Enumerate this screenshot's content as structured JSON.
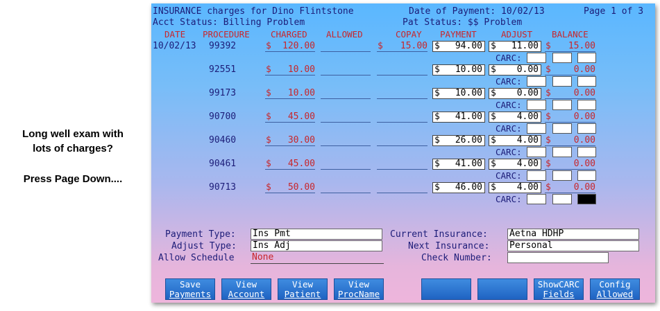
{
  "side_note": {
    "line1": "Long well exam with",
    "line2": "lots of charges?",
    "line3": "Press Page Down...."
  },
  "header": {
    "title": "INSURANCE charges for Dino Flintstone",
    "date_of_payment": "Date of Payment: 10/02/13",
    "page": "Page 1 of 3",
    "acct_status": "Acct Status: Billing Problem",
    "pat_status": "Pat Status: $$ Problem"
  },
  "columns": {
    "date": "DATE",
    "procedure": "PROCEDURE",
    "charged": "CHARGED",
    "allowed": "ALLOWED",
    "copay": "COPAY",
    "payment": "PAYMENT",
    "adjust": "ADJUST",
    "balance": "BALANCE"
  },
  "rows": [
    {
      "date": "10/02/13",
      "procedure": "99392",
      "charged": "120.00",
      "allowed": "",
      "copay": "15.00",
      "payment": "94.00",
      "adjust": "11.00",
      "balance": "15.00"
    },
    {
      "date": "",
      "procedure": "92551",
      "charged": "10.00",
      "allowed": "",
      "copay": "",
      "payment": "10.00",
      "adjust": "0.00",
      "balance": "0.00"
    },
    {
      "date": "",
      "procedure": "99173",
      "charged": "10.00",
      "allowed": "",
      "copay": "",
      "payment": "10.00",
      "adjust": "0.00",
      "balance": "0.00"
    },
    {
      "date": "",
      "procedure": "90700",
      "charged": "45.00",
      "allowed": "",
      "copay": "",
      "payment": "41.00",
      "adjust": "4.00",
      "balance": "0.00"
    },
    {
      "date": "",
      "procedure": "90460",
      "charged": "30.00",
      "allowed": "",
      "copay": "",
      "payment": "26.00",
      "adjust": "4.00",
      "balance": "0.00"
    },
    {
      "date": "",
      "procedure": "90461",
      "charged": "45.00",
      "allowed": "",
      "copay": "",
      "payment": "41.00",
      "adjust": "4.00",
      "balance": "0.00"
    },
    {
      "date": "",
      "procedure": "90713",
      "charged": "50.00",
      "allowed": "",
      "copay": "",
      "payment": "46.00",
      "adjust": "4.00",
      "balance": "0.00"
    }
  ],
  "currency_symbol": "$",
  "carc_label": "CARC:",
  "form": {
    "payment_type_label": "Payment Type:",
    "payment_type": "Ins Pmt",
    "adjust_type_label": "Adjust Type:",
    "adjust_type": "Ins Adj",
    "allow_schedule_label": "Allow Schedule",
    "allow_schedule": "None",
    "current_insurance_label": "Current Insurance:",
    "current_insurance": "Aetna HDHP",
    "next_insurance_label": "Next Insurance:",
    "next_insurance": "Personal",
    "check_number_label": "Check Number:",
    "check_number": ""
  },
  "fkeys": [
    {
      "line1": "Save",
      "line2": "Payments"
    },
    {
      "line1": "View",
      "line2": "Account"
    },
    {
      "line1": "View",
      "line2": "Patient"
    },
    {
      "line1": "View",
      "line2": "ProcName"
    },
    {
      "line1": "",
      "line2": ""
    },
    {
      "line1": "",
      "line2": ""
    },
    {
      "line1": "ShowCARC",
      "line2": "Fields"
    },
    {
      "line1": "Config",
      "line2": "Allowed"
    }
  ]
}
